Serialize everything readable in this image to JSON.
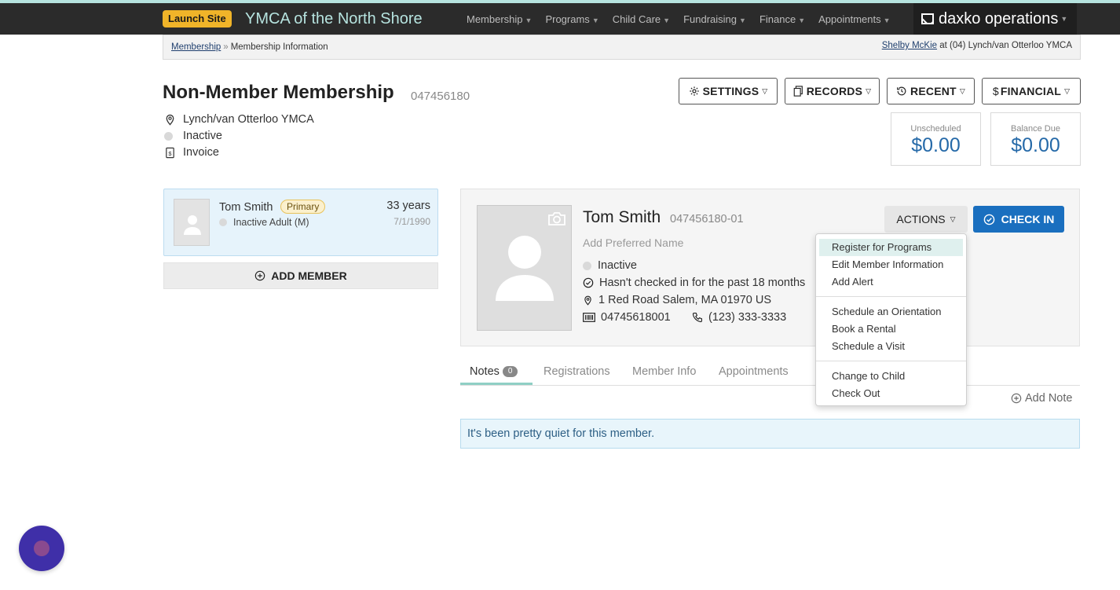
{
  "topbar": {
    "launch_label": "Launch Site",
    "org_name": "YMCA of the North Shore",
    "nav": [
      "Membership",
      "Programs",
      "Child Care",
      "Fundraising",
      "Finance",
      "Appointments"
    ],
    "brand": "daxko operations"
  },
  "breadcrumb": {
    "root": "Membership",
    "separator": "»",
    "current": "Membership Information",
    "user": "Shelby McKie",
    "location_text": "at (04) Lynch/van Otterloo YMCA"
  },
  "membership": {
    "title": "Non-Member Membership",
    "id": "047456180",
    "location": "Lynch/van Otterloo YMCA",
    "status": "Inactive",
    "billing": "Invoice"
  },
  "toolbar": {
    "settings": "SETTINGS",
    "records": "RECORDS",
    "recent": "RECENT",
    "financial": "FINANCIAL"
  },
  "balances": {
    "unscheduled_label": "Unscheduled",
    "unscheduled_amount": "$0.00",
    "balance_label": "Balance Due",
    "balance_amount": "$0.00"
  },
  "member_card": {
    "name": "Tom Smith",
    "role_badge": "Primary",
    "status": "Inactive Adult (M)",
    "age": "33 years",
    "dob": "7/1/1990"
  },
  "add_member_label": "ADD MEMBER",
  "profile": {
    "name": "Tom Smith",
    "id": "047456180-01",
    "preferred_placeholder": "Add Preferred Name",
    "status": "Inactive",
    "checkin_status": "Hasn't checked in for the past 18 months",
    "address": "1 Red Road Salem, MA 01970 US",
    "barcode": "04745618001",
    "phone": "(123) 333-3333",
    "actions_label": "ACTIONS",
    "checkin_label": "CHECK IN"
  },
  "actions_menu": {
    "group1": [
      "Register for Programs",
      "Edit Member Information",
      "Add Alert"
    ],
    "group2": [
      "Schedule an Orientation",
      "Book a Rental",
      "Schedule a Visit"
    ],
    "group3": [
      "Change to Child",
      "Check Out"
    ],
    "highlighted": "Register for Programs"
  },
  "tabs": {
    "notes": "Notes",
    "notes_count": "0",
    "registrations": "Registrations",
    "member_info": "Member Info",
    "appointments": "Appointments"
  },
  "add_note_label": "Add Note",
  "empty_message": "It's been pretty quiet for this member.",
  "colors": {
    "primary_blue": "#1a6fbf",
    "amount_blue": "#2569a8",
    "launch_yellow": "#f0b429",
    "org_teal": "#b6e3df",
    "chat_purple": "#3f2fa8"
  },
  "icons": [
    "location-pin-icon",
    "status-dot-icon",
    "invoice-icon",
    "gear-icon",
    "copy-icon",
    "history-icon",
    "dollar-icon",
    "camera-icon",
    "check-circle-icon",
    "phone-icon",
    "barcode-icon",
    "plus-circle-icon",
    "chat-bubble-icon"
  ]
}
